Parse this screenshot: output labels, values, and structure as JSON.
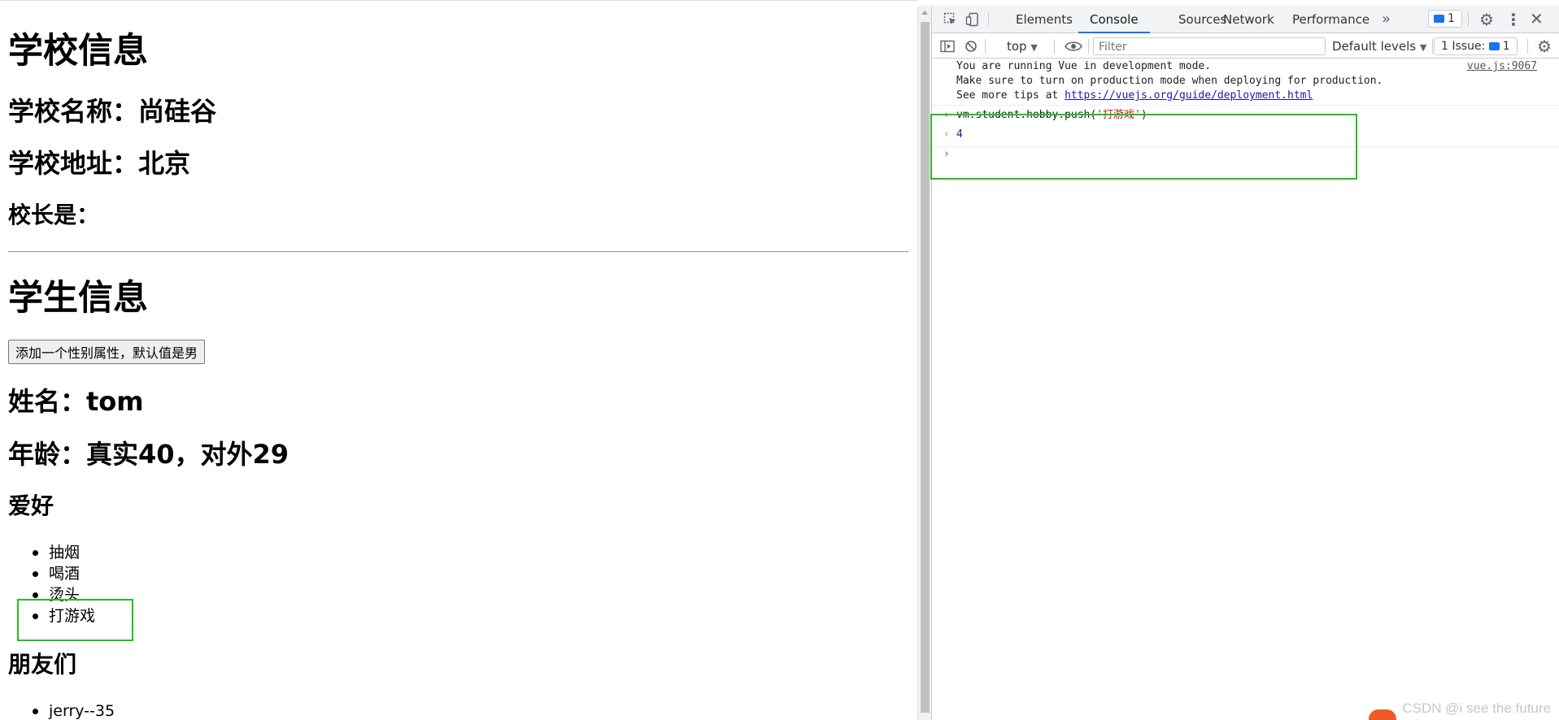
{
  "page": {
    "school_heading": "学校信息",
    "school_name": "学校名称：尚硅谷",
    "school_address": "学校地址：北京",
    "principal": "校长是：",
    "student_heading": "学生信息",
    "add_gender_button": "添加一个性别属性，默认值是男",
    "student_name": "姓名：tom",
    "student_age": "年龄：真实40，对外29",
    "hobby_heading": "爱好",
    "hobbies": [
      "抽烟",
      "喝酒",
      "烫头",
      "打游戏"
    ],
    "friends_heading": "朋友们",
    "friends": [
      "jerry--35"
    ]
  },
  "devtools": {
    "tabs": [
      "Elements",
      "Console",
      "Sources",
      "Network",
      "Performance"
    ],
    "active_tab": "Console",
    "more_tabs_icon": "double-chevron-right-icon",
    "issues_badge_count": "1",
    "toolbar": {
      "context": "top",
      "filter_placeholder": "Filter",
      "levels": "Default levels",
      "issues_label": "1 Issue:",
      "issues_count": "1"
    },
    "console": {
      "vue_msg_line1": "You are running Vue in development mode.",
      "vue_msg_line2": "Make sure to turn on production mode when deploying for production.",
      "vue_msg_line3_prefix": "See more tips at ",
      "vue_msg_link": "https://vuejs.org/guide/deployment.html",
      "vue_msg_source": "vue.js:9067",
      "input_prefix": "vm.student.hobby.push(",
      "input_arg": "'打游戏'",
      "input_suffix": ")",
      "result": "4"
    }
  },
  "watermark": "CSDN @i see the future",
  "colors": {
    "highlight_box": "#22c022",
    "active_tab_underline": "#1a73e8",
    "link": "#1a1aa6",
    "string_literal": "#c41a16"
  }
}
